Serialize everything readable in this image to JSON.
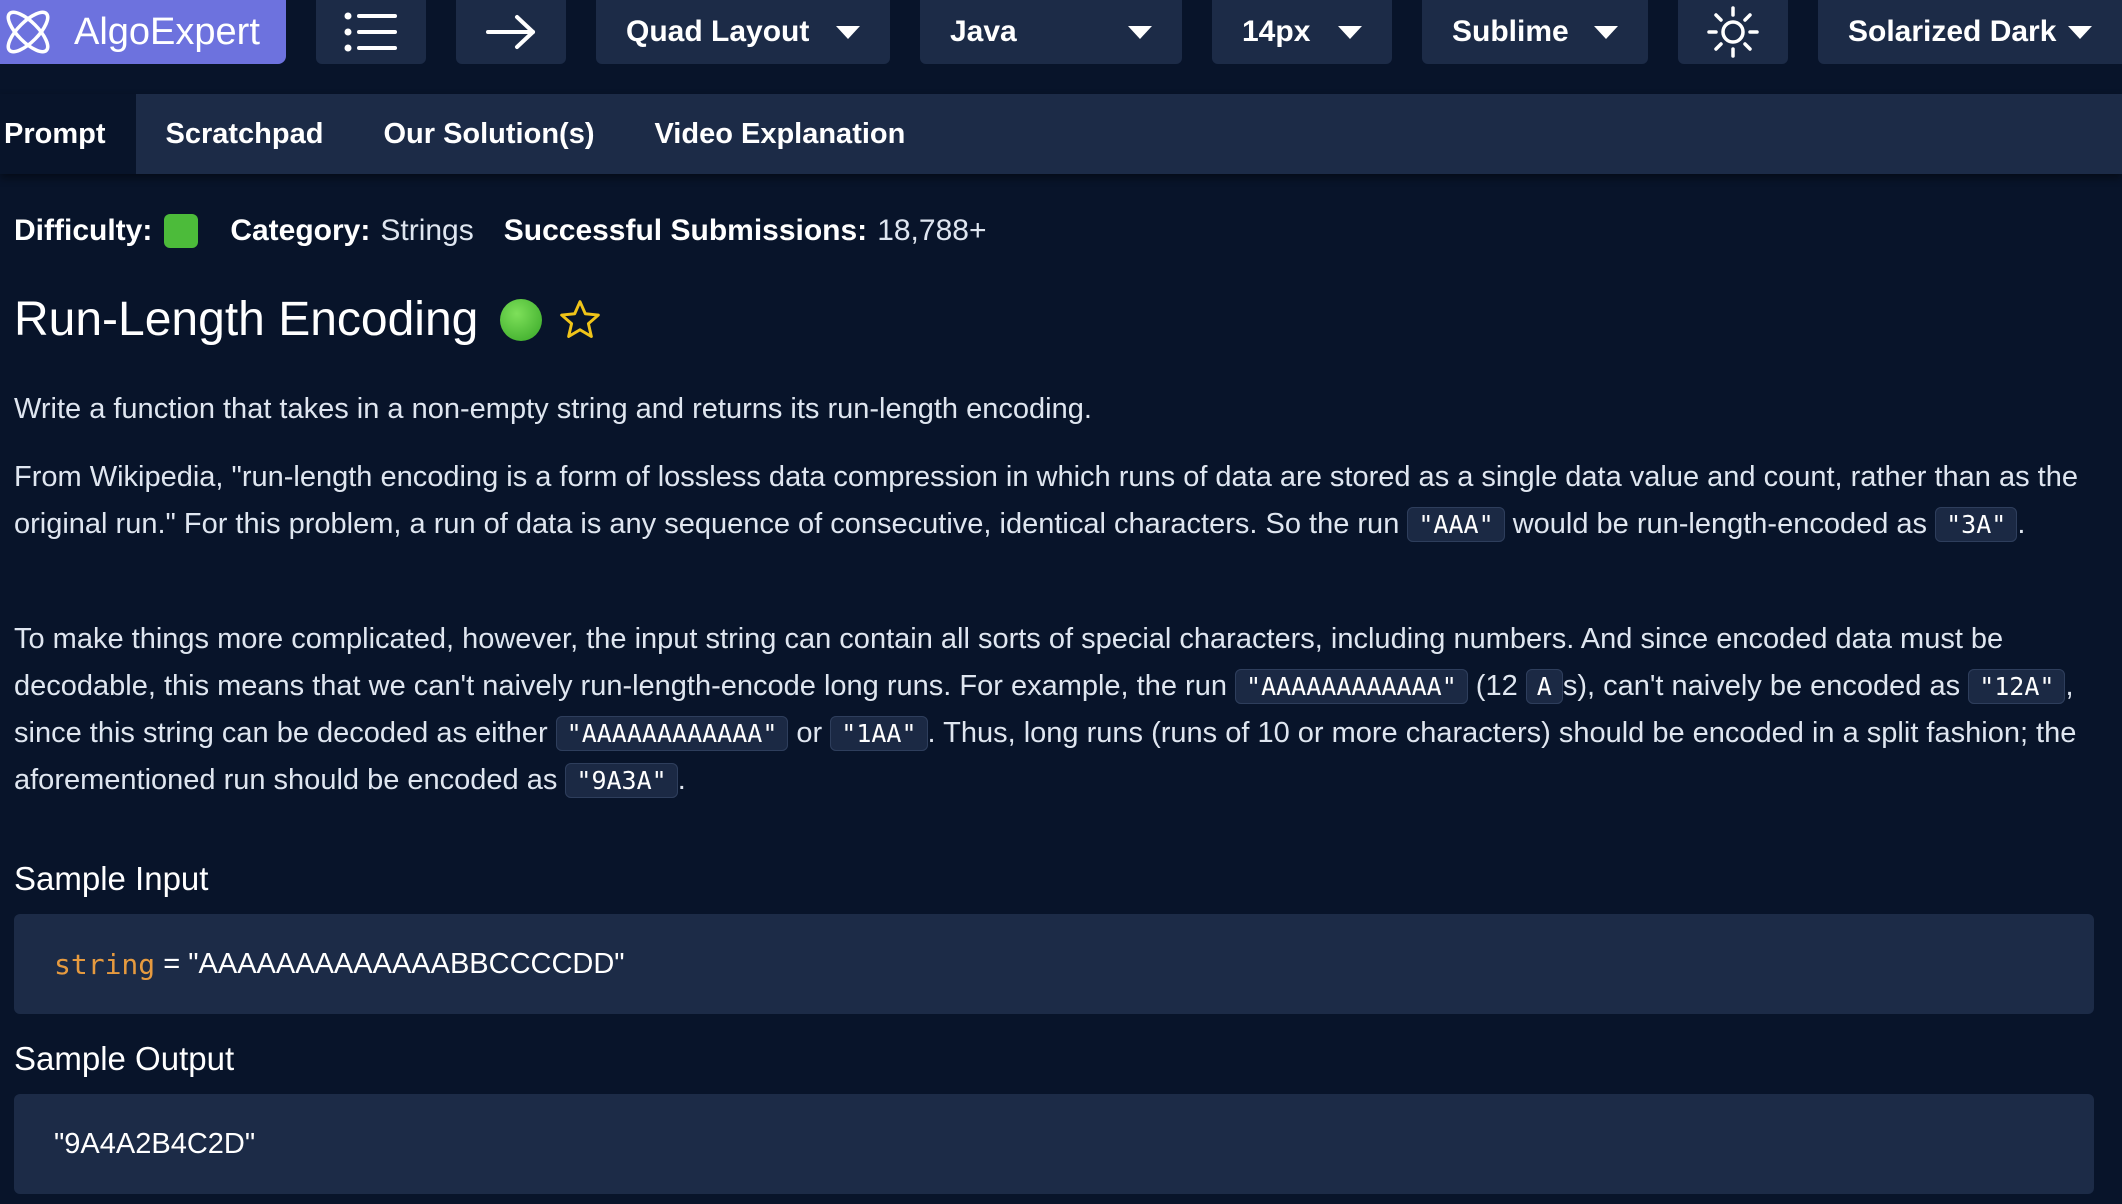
{
  "toolbar": {
    "logo_text": "AlgoExpert",
    "layout": "Quad Layout",
    "language": "Java",
    "font_size": "14px",
    "keymap": "Sublime",
    "theme": "Solarized Dark"
  },
  "tabs": [
    "Prompt",
    "Scratchpad",
    "Our Solution(s)",
    "Video Explanation"
  ],
  "meta": {
    "difficulty_label": "Difficulty:",
    "category_label": "Category:",
    "category": "Strings",
    "submissions_label": "Successful Submissions:",
    "submissions": "18,788+"
  },
  "problem": {
    "title": "Run-Length Encoding",
    "p1": "Write a function that takes in a non-empty string and returns its run-length encoding.",
    "p2_a": "From Wikipedia, \"run-length encoding is a form of lossless data compression in which runs of data are stored as a single data value and count, rather than as the original run.\" For this problem, a run of data is any sequence of consecutive, identical characters. So the run ",
    "p2_code1": "\"AAA\"",
    "p2_b": " would be run-length-encoded as ",
    "p2_code2": "\"3A\"",
    "p2_c": ".",
    "p3_a": "To make things more complicated, however, the input string can contain all sorts of special characters, including numbers. And since encoded data must be decodable, this means that we can't naively run-length-encode long runs. For example, the run ",
    "p3_code1": "\"AAAAAAAAAAAA\"",
    "p3_b": " (12 ",
    "p3_code2": "A",
    "p3_c": "s), can't naively be encoded as ",
    "p3_code3": "\"12A\"",
    "p3_d": ", since this string can be decoded as either ",
    "p3_code4": "\"AAAAAAAAAAAA\"",
    "p3_e": " or ",
    "p3_code5": "\"1AA\"",
    "p3_f": ". Thus, long runs (runs of 10 or more characters) should be encoded in a split fashion; the aforementioned run should be encoded as ",
    "p3_code6": "\"9A3A\"",
    "p3_g": "."
  },
  "sample_input": {
    "heading": "Sample Input",
    "var": "string",
    "eq": " = ",
    "value": "\"AAAAAAAAAAAAABBCCCCDD\""
  },
  "sample_output": {
    "heading": "Sample Output",
    "value": "\"9A4A2B4C2D\""
  },
  "colors": {
    "background": "#08142a",
    "panel": "#1c2b47",
    "accent": "#6d72de",
    "difficulty_easy": "#4cbb3a",
    "keyword": "#e69a3f",
    "star": "#f0c419"
  }
}
